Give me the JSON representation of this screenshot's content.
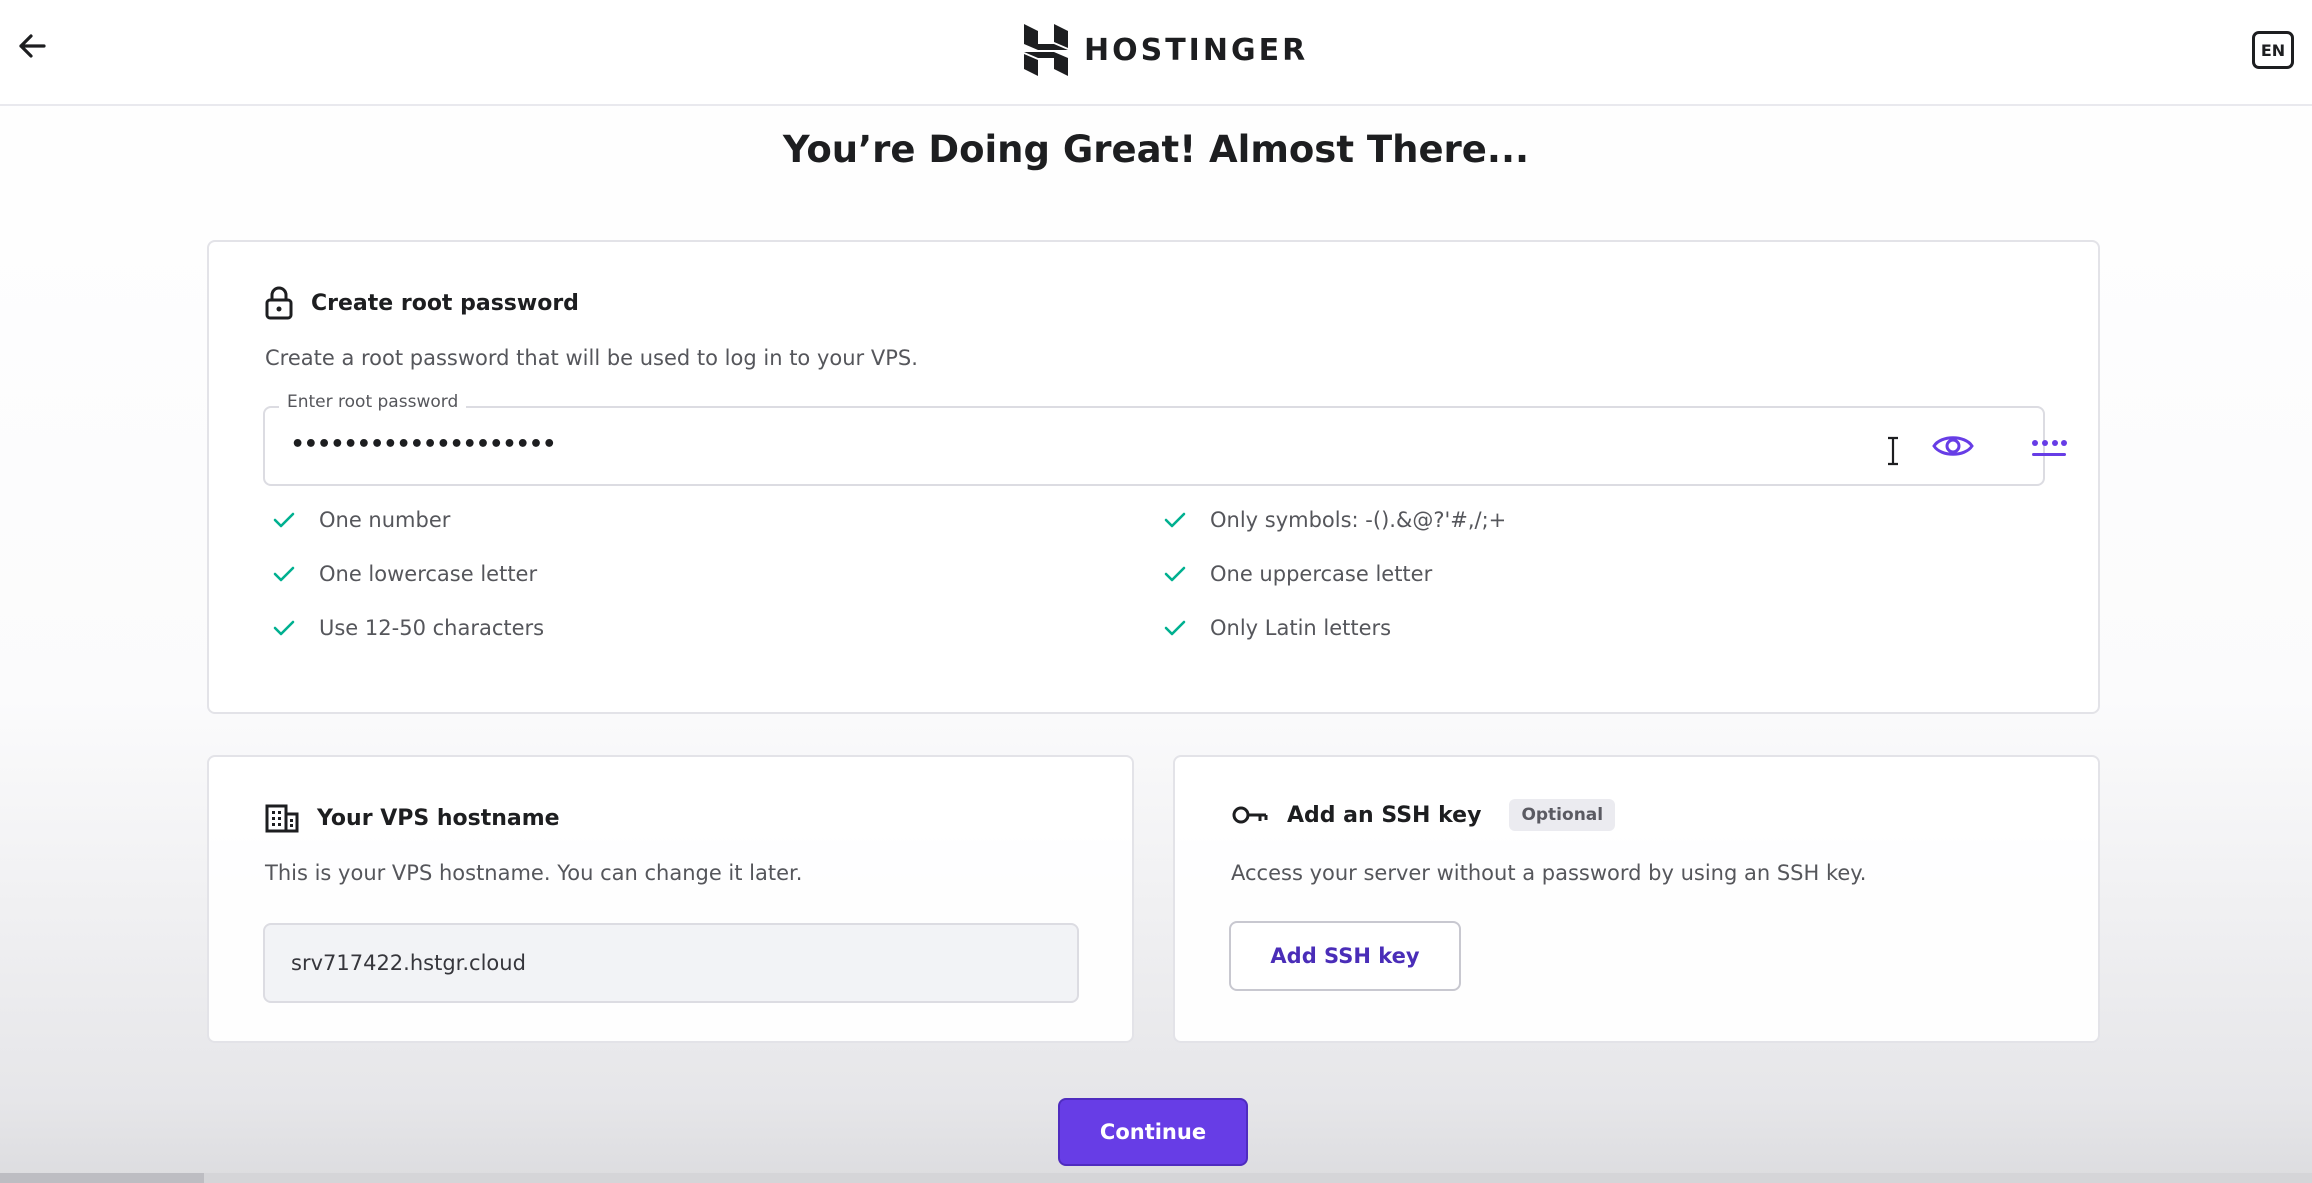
{
  "header": {
    "back_icon": "arrow-left-icon",
    "logo_icon": "hostinger-logo-icon",
    "logo_text": "HOSTINGER",
    "language": "EN"
  },
  "page": {
    "title": "You’re Doing Great! Almost There..."
  },
  "root_password": {
    "icon": "lock-icon",
    "title": "Create root password",
    "description": "Create a root password that will be used to log in to your VPS.",
    "field_label": "Enter root password",
    "field_value": "••••••••••••••••••••",
    "show_icon": "eye-icon",
    "generate_icon": "generate-password-icon",
    "requirements_left": [
      {
        "label": "One number",
        "met": true
      },
      {
        "label": "One lowercase letter",
        "met": true
      },
      {
        "label": "Use 12-50 characters",
        "met": true
      }
    ],
    "requirements_right": [
      {
        "label": "Only symbols: -().&@?'#,/;+",
        "met": true
      },
      {
        "label": "One uppercase letter",
        "met": true
      },
      {
        "label": "Only Latin letters",
        "met": true
      }
    ]
  },
  "hostname": {
    "icon": "building-icon",
    "title": "Your VPS hostname",
    "description": "This is your VPS hostname. You can change it later.",
    "value": "srv717422.hstgr.cloud"
  },
  "ssh": {
    "icon": "key-icon",
    "title": "Add an SSH key",
    "badge": "Optional",
    "description": "Access your server without a password by using an SSH key.",
    "button_label": "Add SSH key"
  },
  "footer": {
    "continue_label": "Continue"
  },
  "colors": {
    "primary": "#673de6",
    "primary_text": "#4a2db8",
    "check": "#00b090",
    "text_dark": "#1d1e20",
    "text_muted": "#55565b"
  }
}
